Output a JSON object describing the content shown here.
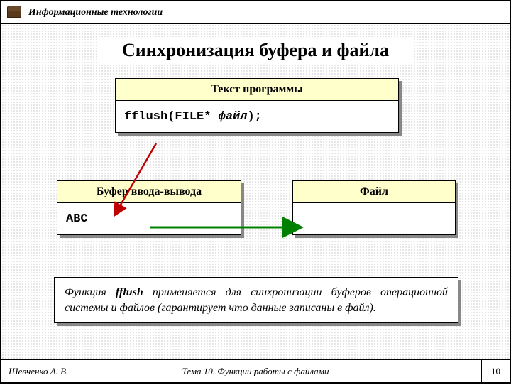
{
  "header": {
    "course": "Информационные технологии"
  },
  "title": "Синхронизация буфера и файла",
  "program_box": {
    "header": "Текст программы",
    "code_fn": "fflush",
    "code_open": "(FILE* ",
    "code_arg": "файл",
    "code_close": ");"
  },
  "buffer_box": {
    "header": "Буфер ввода-вывода",
    "content": "ABC"
  },
  "file_box": {
    "header": "Файл",
    "content": ""
  },
  "description": {
    "pre": "Функция ",
    "fn": "fflush",
    "post": " применяется для синхронизации буферов операционной системы и файлов (гарантирует что данные записаны в файл)."
  },
  "footer": {
    "author": "Шевченко А. В.",
    "topic": "Тема 10. Функции работы с файлами",
    "page": "10"
  }
}
